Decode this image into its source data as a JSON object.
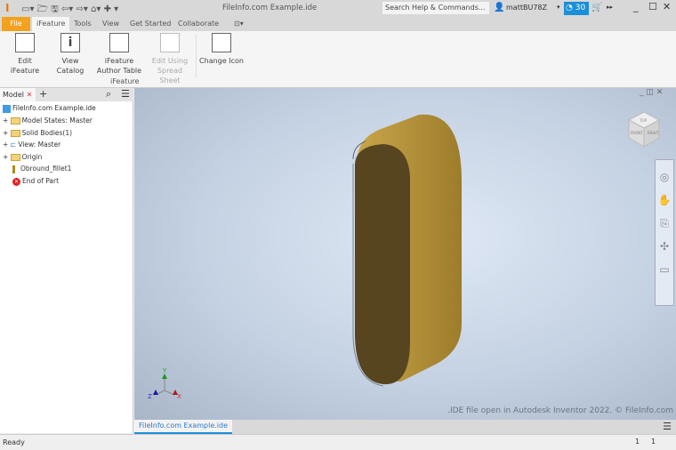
{
  "title": "FileInfo.com Example.ide",
  "search_placeholder": "Search Help & Commands...",
  "user": "mattBU78Z",
  "trial_days": "30",
  "tabs": [
    "File",
    "iFeature",
    "Tools",
    "View",
    "Get Started",
    "Collaborate"
  ],
  "ribbon": {
    "buttons": [
      "Edit iFeature",
      "View Catalog",
      "iFeature Author Table",
      "Edit Using Spread Sheet",
      "Change Icon"
    ],
    "panel_label": "iFeature"
  },
  "browser": {
    "tab": "Model",
    "items": [
      "FileInfo.com Example.ide",
      "Model States: Master",
      "Solid Bodies(1)",
      "View: Master",
      "Origin",
      "Obround_fillet1",
      "End of Part"
    ]
  },
  "viewcube": {
    "top": "TOP",
    "front": "FRONT",
    "right": "RIGHT"
  },
  "axes": {
    "x": "X",
    "y": "Y",
    "z": "Z"
  },
  "watermark": ".IDE file open in Autodesk Inventor 2022. © FileInfo.com",
  "doc_tab": "FileInfo.com Example.ide",
  "status": {
    "text": "Ready",
    "n1": "1",
    "n2": "1"
  },
  "colors": {
    "file_tab": "#f4a21d",
    "accent": "#1b8fd8"
  }
}
